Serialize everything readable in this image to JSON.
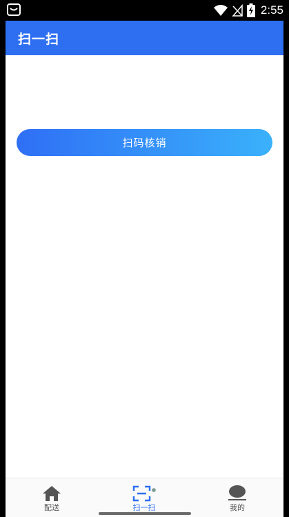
{
  "status_bar": {
    "time": "2:55",
    "left_icon": "notification-icon",
    "icons": [
      "wifi-icon",
      "no-signal-icon",
      "battery-charging-icon"
    ]
  },
  "header": {
    "title": "扫一扫",
    "background_color": "#2e6ff2"
  },
  "main": {
    "scan_button_label": "扫码核销",
    "scan_button_gradient": [
      "#2f6ff5",
      "#3ab1fb"
    ]
  },
  "bottom_nav": {
    "items": [
      {
        "label": "配送",
        "icon": "home-icon",
        "active": false
      },
      {
        "label": "扫一扫",
        "icon": "scan-icon",
        "active": true
      },
      {
        "label": "我的",
        "icon": "profile-icon",
        "active": false
      }
    ],
    "active_color": "#2e6ff2"
  }
}
